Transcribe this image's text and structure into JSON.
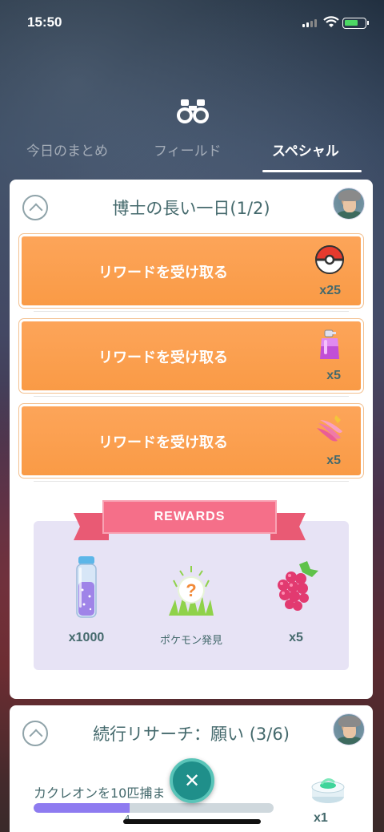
{
  "status_bar": {
    "time": "15:50"
  },
  "tabs": [
    {
      "label": "今日のまとめ",
      "active": false
    },
    {
      "label": "フィールド",
      "active": false
    },
    {
      "label": "スペシャル",
      "active": true
    }
  ],
  "special_research": {
    "title": "博士の長い一日(1/2)",
    "reward_buttons": [
      {
        "label": "リワードを受け取る",
        "icon": "poke-ball-icon",
        "quantity": "x25"
      },
      {
        "label": "リワードを受け取る",
        "icon": "potion-icon",
        "quantity": "x5"
      },
      {
        "label": "リワードを受け取る",
        "icon": "banana-berry-icon",
        "quantity": "x5"
      }
    ],
    "rewards_banner": "REWARDS",
    "rewards": [
      {
        "icon": "stardust-vial-icon",
        "label": "x1000"
      },
      {
        "icon": "pokemon-encounter-icon",
        "label": "ポケモン発見"
      },
      {
        "icon": "razz-berry-icon",
        "label": "x5"
      }
    ]
  },
  "ongoing_research": {
    "title": "続行リサーチ：願い (3/6)",
    "task": "カクレオンを10匹捕ま",
    "progress_value": "4",
    "progress_fraction": 0.4,
    "reward": {
      "icon": "incense-icon",
      "quantity": "x1"
    }
  },
  "colors": {
    "accent_orange": "#f99a45",
    "teal_text": "#44696c",
    "ribbon_pink": "#f56f89",
    "progress_purple": "#8e7bf0"
  }
}
